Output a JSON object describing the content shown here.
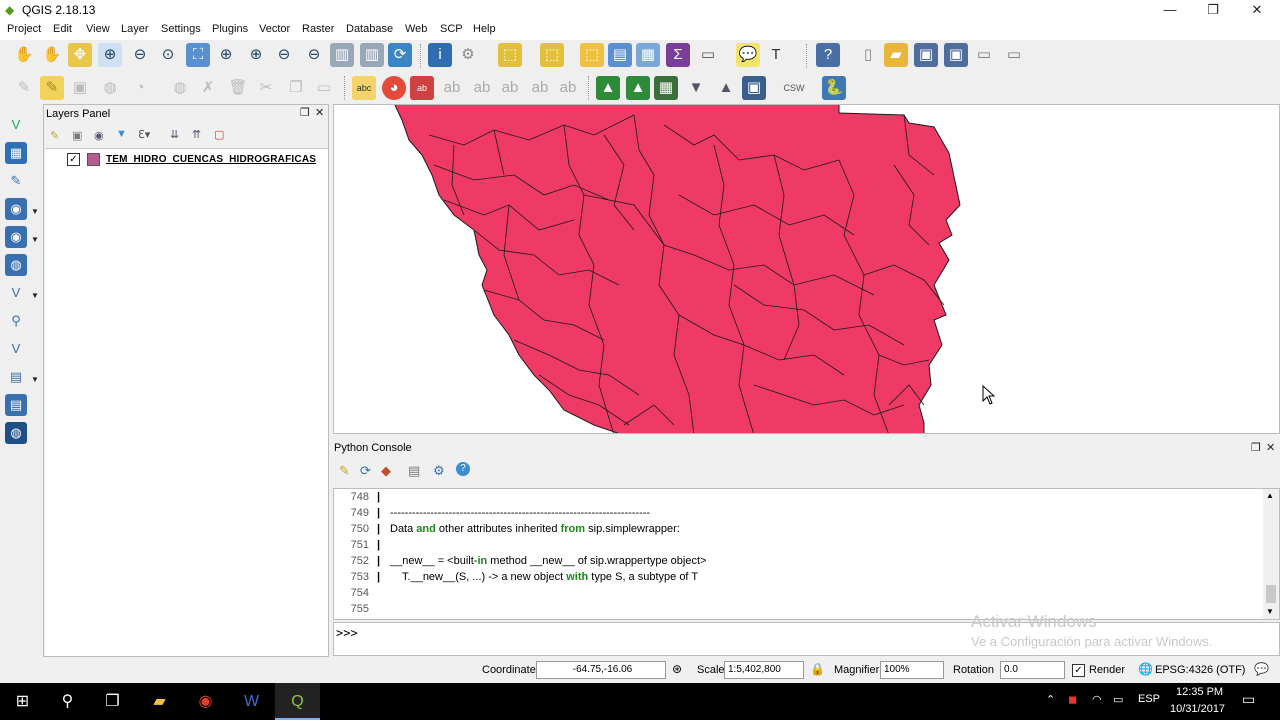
{
  "window": {
    "title": "QGIS 2.18.13",
    "minimize": "—",
    "restore": "❐",
    "close": "✕"
  },
  "menu": [
    "Project",
    "Edit",
    "View",
    "Layer",
    "Settings",
    "Plugins",
    "Vector",
    "Raster",
    "Database",
    "Web",
    "SCP",
    "Help"
  ],
  "layers_panel": {
    "title": "Layers Panel",
    "layers": [
      {
        "name": "TEM_HIDRO_CUENCAS_HIDROGRAFICAS",
        "checked": true,
        "fill_color": "#b45c8e"
      }
    ]
  },
  "map": {
    "feature_fill": "#ee3a64",
    "feature_stroke": "#1a1a1a"
  },
  "python_console": {
    "title": "Python Console",
    "lines": [
      {
        "num": "748",
        "text": ""
      },
      {
        "num": "749",
        "text": "-----------------------------------------------------------------------"
      },
      {
        "num": "750",
        "pre": "Data ",
        "kw1": "and",
        "mid": " other attributes inherited ",
        "kw2": "from",
        "post": " sip.simplewrapper:"
      },
      {
        "num": "751",
        "text": ""
      },
      {
        "num": "752",
        "pre": "__new__ = <built-",
        "kw1": "in",
        "mid": " method __new__ of sip.wrappertype object>",
        "kw2": "",
        "post": ""
      },
      {
        "num": "753",
        "pre": "    T.__new__(S, ...) -> a new object ",
        "kw1": "with",
        "mid": " type S, a subtype of T",
        "kw2": "",
        "post": ""
      },
      {
        "num": "754",
        "text": ""
      },
      {
        "num": "755",
        "text": ""
      }
    ],
    "prompt": ">>>"
  },
  "watermark": {
    "line1": "Activar Windows",
    "line2": "Ve a Configuración para activar Windows."
  },
  "statusbar": {
    "coordinate_label": "Coordinate",
    "coordinate_value": "-64.75,-16.06",
    "scale_label": "Scale",
    "scale_value": "1:5,402,800",
    "magnifier_label": "Magnifier",
    "magnifier_value": "100%",
    "rotation_label": "Rotation",
    "rotation_value": "0.0",
    "render_label": "Render",
    "crs": "EPSG:4326 (OTF)"
  },
  "taskbar": {
    "lang": "ESP",
    "time": "12:35 PM",
    "date": "10/31/2017"
  }
}
